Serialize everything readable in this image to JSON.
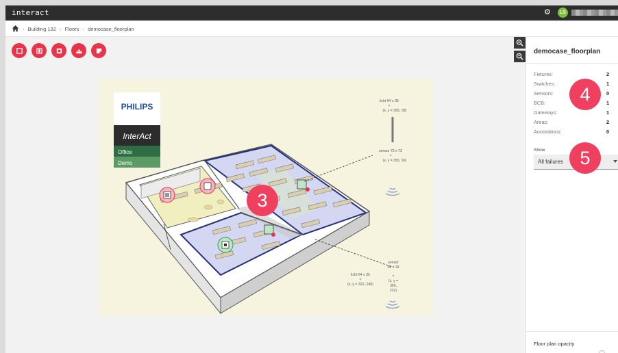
{
  "app": {
    "title": "interact"
  },
  "user": {
    "initials": "LS"
  },
  "breadcrumb": {
    "items": [
      "Building 132",
      "Floors",
      "democase_floorplan"
    ],
    "separator": "›"
  },
  "toolbar": {
    "tools": [
      "fixture-tool-icon",
      "switch-tool-icon",
      "sensor-tool-icon",
      "gateway-tool-icon",
      "annotation-tool-icon"
    ],
    "accent_color": "#e8334a"
  },
  "zoom": {
    "in_icon": "zoom-in-icon",
    "out_icon": "zoom-out-icon"
  },
  "floorplan": {
    "brand": {
      "logo": "PHILIPS",
      "product": "InterAct",
      "line1": "Office",
      "line2": "Demo"
    },
    "annotations": [
      {
        "label": "licht 64 x 35",
        "coords": "(x, y = 365, 39)"
      },
      {
        "label": "sensor 72 x 72",
        "coords": "(x, y = 355, 90)"
      },
      {
        "label": "sensor",
        "size": "50 x 19"
      },
      {
        "label": "licht 64 x 35",
        "coords": "(x, y = 322, 240)"
      },
      {
        "coords_label": "(x, y =",
        "coords_values": [
          "365,",
          "232)"
        ]
      }
    ]
  },
  "panel": {
    "title": "democase_floorplan",
    "stats": [
      {
        "label": "Fixtures:",
        "value": "2"
      },
      {
        "label": "Switches:",
        "value": "1"
      },
      {
        "label": "Sensors:",
        "value": "0"
      },
      {
        "label": "BCB:",
        "value": "1"
      },
      {
        "label": "Gateways:",
        "value": "1"
      },
      {
        "label": "Areas:",
        "value": "2"
      },
      {
        "label": "Annotations:",
        "value": "0"
      }
    ],
    "show_label": "Show",
    "show_value": "All failures",
    "opacity_label": "Floor plan opacity",
    "opacity_value": 0.8
  },
  "callouts": [
    "3",
    "4",
    "5"
  ]
}
